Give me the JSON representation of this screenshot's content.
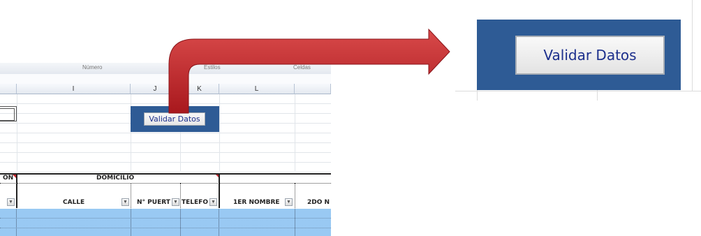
{
  "button": {
    "label": "Validar Datos"
  },
  "sheet": {
    "ribbon": [
      "Número",
      "Estilos",
      "Celdas"
    ],
    "columns": [
      "I",
      "J",
      "K",
      "L"
    ],
    "group_headers": {
      "left_partial": "ON",
      "domicilio": "DOMICILIO"
    },
    "fields": {
      "calle": "CALLE",
      "puerta": "N° PUERT",
      "telefono": "TELEFO",
      "nombre1": "1ER NOMBRE",
      "nombre2": "2DO N"
    }
  },
  "colors": {
    "panel": "#2e5b95",
    "button_text": "#1c2f8c",
    "arrow": "#c0262c",
    "row_fill": "#99c9f3"
  },
  "icons": {
    "arrow": "curved-arrow-icon",
    "filter": "filter-dropdown-icon"
  }
}
